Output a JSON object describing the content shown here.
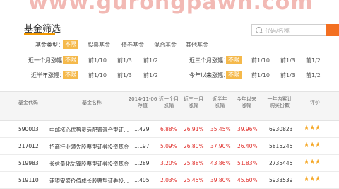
{
  "watermark": "www.gurongpawn.com",
  "page": {
    "title": "基金筛选"
  },
  "search": {
    "placeholder": "代码/名称"
  },
  "filters": {
    "fund_type": {
      "label": "基金类型：",
      "selected": "不限",
      "options": [
        "股票基金",
        "债券基金",
        "混合基金",
        "其他基金"
      ]
    },
    "one_month": {
      "label": "近一个月涨幅：",
      "selected": "不限",
      "options": [
        "前1/10",
        "前1/3",
        "前1/2"
      ]
    },
    "three_month": {
      "label": "近三个月涨幅：",
      "selected": "不限",
      "options": [
        "前1/10",
        "前1/3",
        "前1/2"
      ]
    },
    "half_year": {
      "label": "近半年涨幅：",
      "selected": "不限",
      "options": [
        "前1/10",
        "前1/3",
        "前1/2"
      ]
    },
    "ytd": {
      "label": "今年以来涨幅：",
      "selected": "不限",
      "options": [
        "前1/10",
        "前1/3",
        "前1/2"
      ]
    }
  },
  "table": {
    "headers": {
      "code": "基金代码",
      "name": "基金名称",
      "nav": [
        "2014-11-06",
        "净值"
      ],
      "m1": [
        "近一个月",
        "涨幅"
      ],
      "m3": [
        "近三十月",
        "涨幅"
      ],
      "h1": [
        "近半年",
        "涨幅"
      ],
      "ytd": [
        "今年以来",
        "涨幅"
      ],
      "cum": [
        "一年内累计",
        "购买份数"
      ],
      "rating": "评价"
    },
    "rows": [
      {
        "code": "590003",
        "name": "中邮核心优势灵活配置混合型证...",
        "nav": "1.429",
        "m1": "6.88%",
        "m3": "26.91%",
        "h1": "35.45%",
        "ytd": "39.96%",
        "cum": "6930823",
        "stars": "★★★"
      },
      {
        "code": "217012",
        "name": "招商行业领先股票型证券投资基金",
        "nav": "1.197",
        "m1": "5.09%",
        "m3": "26.80%",
        "h1": "37.90%",
        "ytd": "26.40%",
        "cum": "5815245",
        "stars": "★★★"
      },
      {
        "code": "519983",
        "name": "长信量化先锋股票型证券投资基金",
        "nav": "1.289",
        "m1": "3.20%",
        "m3": "25.88%",
        "h1": "43.86%",
        "ytd": "51.83%",
        "cum": "2735445",
        "stars": "★★★"
      },
      {
        "code": "519110",
        "name": "浦银安盛价值成长股票型证券投...",
        "nav": "1.405",
        "m1": "2.03%",
        "m3": "25.45%",
        "h1": "39.80%",
        "ytd": "45.60%",
        "cum": "5933539",
        "stars": "★★★"
      }
    ]
  }
}
